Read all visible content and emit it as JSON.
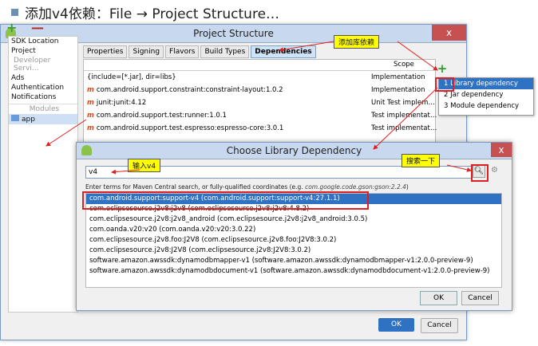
{
  "heading": "添加v4依赖：File → Project Structure…",
  "project_structure": {
    "title": "Project Structure",
    "close": "x",
    "toolbar": {
      "add": "+",
      "remove": "—"
    },
    "sidebar": {
      "items": [
        "SDK Location",
        "Project",
        "Developer Servi…",
        "Ads",
        "Authentication",
        "Notifications"
      ],
      "section_developer": "Developer Servi…",
      "section_modules": "Modules",
      "app": "app"
    },
    "tabs": [
      "Properties",
      "Signing",
      "Flavors",
      "Build Types",
      "Dependencies"
    ],
    "scope_header": "Scope",
    "dependencies": [
      {
        "name": "{include=[*.jar], dir=libs}",
        "scope": "Implementation",
        "maven": false
      },
      {
        "name": "com.android.support.constraint:constraint-layout:1.0.2",
        "scope": "Implementation",
        "maven": true
      },
      {
        "name": "junit:junit:4.12",
        "scope": "Unit Test implem…",
        "maven": true
      },
      {
        "name": "com.android.support.test:runner:1.0.1",
        "scope": "Test implementat…",
        "maven": true
      },
      {
        "name": "com.android.support.test.espresso:espresso-core:3.0.1",
        "scope": "Test implementat…",
        "maven": true
      }
    ],
    "add_menu": [
      "1  Library dependency",
      "2  Jar dependency",
      "3  Module dependency"
    ],
    "ok": "OK",
    "cancel": "Cancel"
  },
  "choose_dialog": {
    "title": "Choose Library Dependency",
    "close": "x",
    "search_value": "v4",
    "hint": "Enter terms for Maven Central search, or fully-qualified coordinates (e.g. ",
    "hint_example": "com.google.code.gson:gson:2.2.4",
    "hint_end": ")",
    "results": [
      "com.android.support:support-v4 (com.android.support:support-v4:27.1.1)",
      "com.eclipsesource.j2v8:j2v8 (com.eclipsesource.j2v8:j2v8:4.8.2)",
      "com.eclipsesource.j2v8:j2v8_android (com.eclipsesource.j2v8:j2v8_android:3.0.5)",
      "com.oanda.v20:v20 (com.oanda.v20:v20:3.0.22)",
      "com.eclipsesource.j2v8.foo:J2V8 (com.eclipsesource.j2v8.foo:J2V8:3.0.2)",
      "com.eclipsesource.j2v8:J2V8 (com.eclipsesource.j2v8:J2V8:3.0.2)",
      "software.amazon.awssdk:dynamodbmapper-v1 (software.amazon.awssdk:dynamodbmapper-v1:2.0.0-preview-9)",
      "software.amazon.awssdk:dynamodbdocument-v1 (software.amazon.awssdk:dynamodbdocument-v1:2.0.0-preview-9)"
    ],
    "ok": "OK",
    "cancel": "Cancel"
  },
  "callouts": {
    "add_library": "添加库依赖",
    "enter_v4": "输入v4",
    "search_it": "搜索一下"
  },
  "colors": {
    "accent": "#2f72c4",
    "callout": "#ffff00",
    "highlight_box": "#e02020"
  }
}
